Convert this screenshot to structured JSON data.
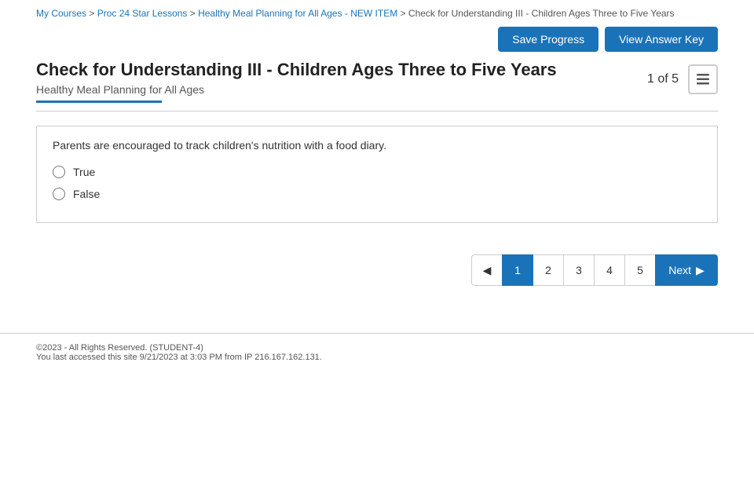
{
  "breadcrumb": {
    "items": [
      {
        "label": "My Courses",
        "href": "#"
      },
      {
        "label": "Proc 24 Star Lessons",
        "href": "#"
      },
      {
        "label": "Healthy Meal Planning for All Ages - NEW ITEM",
        "href": "#"
      },
      {
        "label": "Check for Understanding III - Children Ages Three to Five Years",
        "href": null
      }
    ],
    "separator": ">"
  },
  "toolbar": {
    "save_label": "Save Progress",
    "answer_key_label": "View Answer Key"
  },
  "quiz": {
    "title": "Check for Understanding III - Children Ages Three to Five Years",
    "subtitle": "Healthy Meal Planning for All Ages",
    "counter": "1 of 5"
  },
  "question": {
    "text": "Parents are encouraged to track children's nutrition with a food diary.",
    "options": [
      {
        "label": "True",
        "value": "true"
      },
      {
        "label": "False",
        "value": "false"
      }
    ]
  },
  "pagination": {
    "prev_label": "◀",
    "pages": [
      "1",
      "2",
      "3",
      "4",
      "5"
    ],
    "current_page": "1",
    "next_label": "Next",
    "next_arrow": "▶"
  },
  "footer": {
    "line1": "©2023 - All Rights Reserved. (STUDENT-4)",
    "line2": "You last accessed this site 9/21/2023 at 3:03 PM from IP 216.167.162.131."
  }
}
